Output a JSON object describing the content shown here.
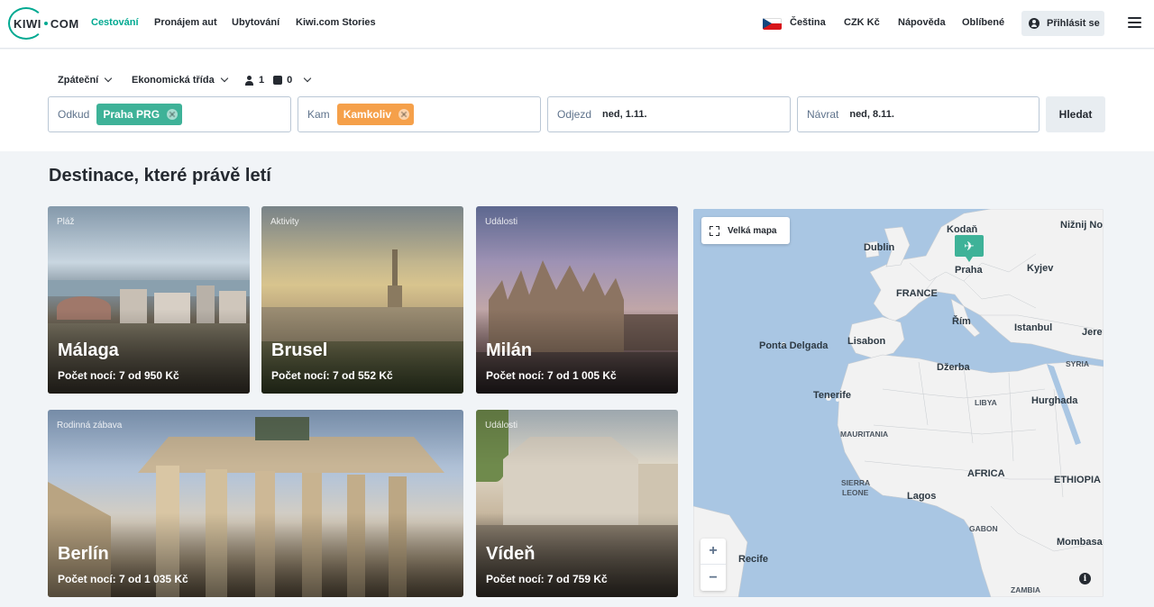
{
  "nav": {
    "logo": "KIWI",
    "logo_suffix": "COM",
    "links": [
      "Cestování",
      "Pronájem aut",
      "Ubytování",
      "Kiwi.com Stories"
    ],
    "language": "Čeština",
    "currency": "CZK Kč",
    "help": "Nápověda",
    "favorites": "Oblíbené",
    "login": "Přihlásit se",
    "accent_color": "#00a991"
  },
  "search": {
    "trip_type": "Zpáteční",
    "cabin_class": "Ekonomická třída",
    "passengers": "1",
    "bags": "0",
    "from_label": "Odkud",
    "from_value": "Praha PRG",
    "to_label": "Kam",
    "to_value": "Kamkoliv",
    "depart_label": "Odjezd",
    "depart_value": "ned, 1.11.",
    "return_label": "Návrat",
    "return_value": "ned, 8.11.",
    "search_button": "Hledat"
  },
  "main": {
    "title": "Destinace, které právě letí",
    "cards": [
      {
        "category": "Pláž",
        "city": "Málaga",
        "price": "Počet nocí: 7 od 950 Kč"
      },
      {
        "category": "Aktivity",
        "city": "Brusel",
        "price": "Počet nocí: 7 od 552 Kč"
      },
      {
        "category": "Události",
        "city": "Milán",
        "price": "Počet nocí: 7 od 1 005 Kč"
      },
      {
        "category": "Rodinná zábava",
        "city": "Berlín",
        "price": "Počet nocí: 7 od 1 035 Kč"
      },
      {
        "category": "Události",
        "city": "Vídeň",
        "price": "Počet nocí: 7 od 759 Kč"
      }
    ]
  },
  "map": {
    "big_map_button": "Velká mapa",
    "zoom_in": "+",
    "zoom_out": "−",
    "info": "i",
    "labels": [
      "Kodaň",
      "Nižnij No",
      "Dublin",
      "Praha",
      "Kyjev",
      "FRANCE",
      "Řím",
      "Istanbul",
      "Ponta Delgada",
      "Lisabon",
      "Jere",
      "Džerba",
      "SYRIA",
      "Tenerife",
      "LIBYA",
      "Hurghada",
      "MAURITANIA",
      "AFRICA",
      "ETHIOPIA",
      "SIERRA",
      "LEONE",
      "Lagos",
      "GABON",
      "Mombasa",
      "Recife",
      "ZAMBIA"
    ]
  }
}
